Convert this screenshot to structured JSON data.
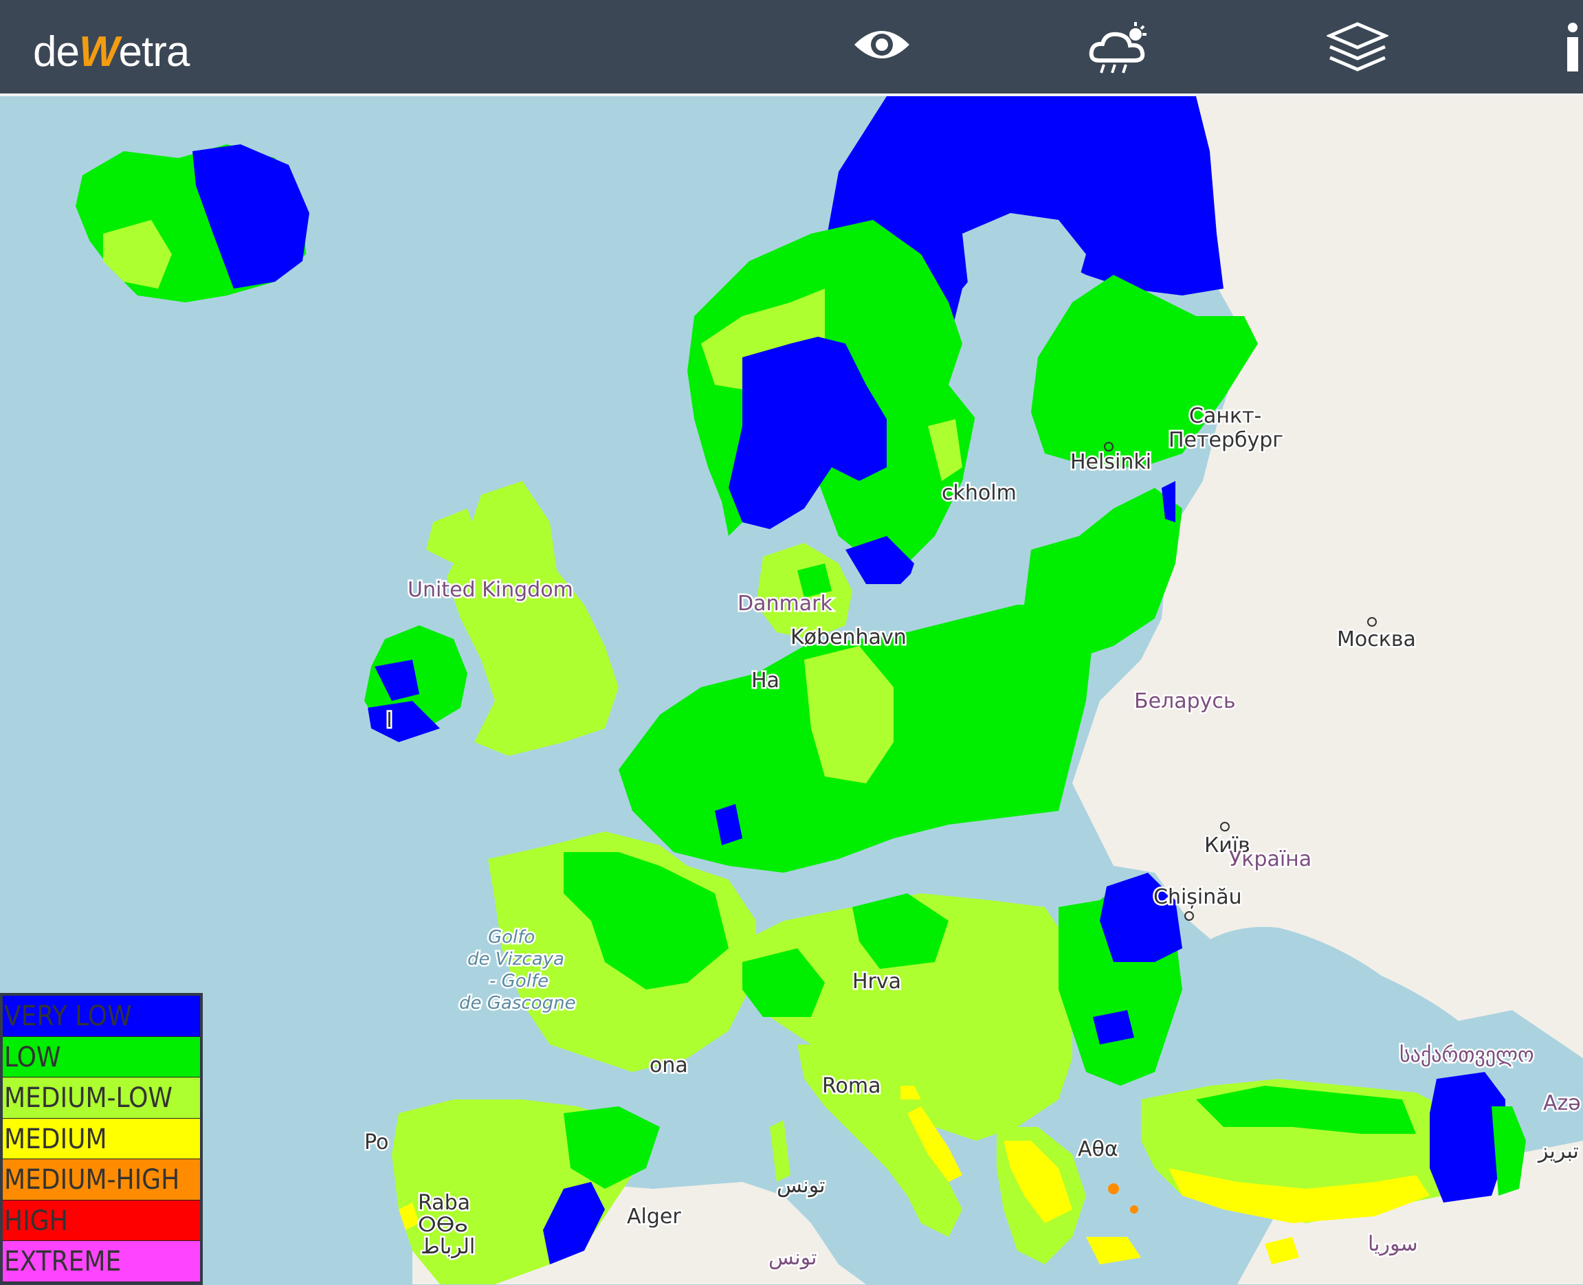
{
  "app": {
    "logo_left": "de",
    "logo_mid": "W",
    "logo_right": "etra"
  },
  "toolbar": {
    "icons": [
      "eye-icon",
      "weather-cloud-icon",
      "layers-icon",
      "info-icon"
    ]
  },
  "menu": {
    "label": "≡"
  },
  "colors": {
    "very_low": "#0000ff",
    "low": "#00ee00",
    "medium_low": "#adff2f",
    "medium": "#ffff00",
    "medium_high": "#ff8c00",
    "high": "#ff0000",
    "extreme": "#ff44ff",
    "sea": "#abd3df",
    "land": "#f2efe9"
  },
  "legend": {
    "items": [
      {
        "label": "VERY LOW",
        "color": "#0000ff"
      },
      {
        "label": "LOW",
        "color": "#00ee00"
      },
      {
        "label": "MEDIUM-LOW",
        "color": "#adff2f"
      },
      {
        "label": "MEDIUM",
        "color": "#ffff00"
      },
      {
        "label": "MEDIUM-HIGH",
        "color": "#ff8c00"
      },
      {
        "label": "HIGH",
        "color": "#ff0000"
      },
      {
        "label": "EXTREME",
        "color": "#ff44ff"
      }
    ]
  },
  "map_labels": {
    "spb1": "Санкт-",
    "spb2": "Петербург",
    "helsinki": "Helsinki",
    "stockholm": "ckholm",
    "uk": "United Kingdom",
    "denmark": "Danmark",
    "kobenhavn": "København",
    "hamburg": "Ha",
    "moskva": "Москва",
    "belarus": "Беларусь",
    "kyiv": "Київ",
    "ukraina": "Україна",
    "chisinau": "Chișinău",
    "golfo1": "Golfo",
    "golfo2": "de Vizcaya",
    "golfo3": "- Golfe",
    "golfo4": "de Gascogne",
    "hrva": "Hrva",
    "roma": "Roma",
    "barcelona": "ona",
    "georgia": "საქართველო",
    "aze": "Azə",
    "tabriz": "تبریز",
    "atha": "Αθα",
    "tunis": "تونس",
    "alger": "Alger",
    "rabat": "Raba",
    "rabat_tif": "ⵔⴱⴰ",
    "rabat_ar": "الرباط",
    "tunis2": "تونس",
    "suriya": "سوريا",
    "po": "Po",
    "i": "I"
  }
}
